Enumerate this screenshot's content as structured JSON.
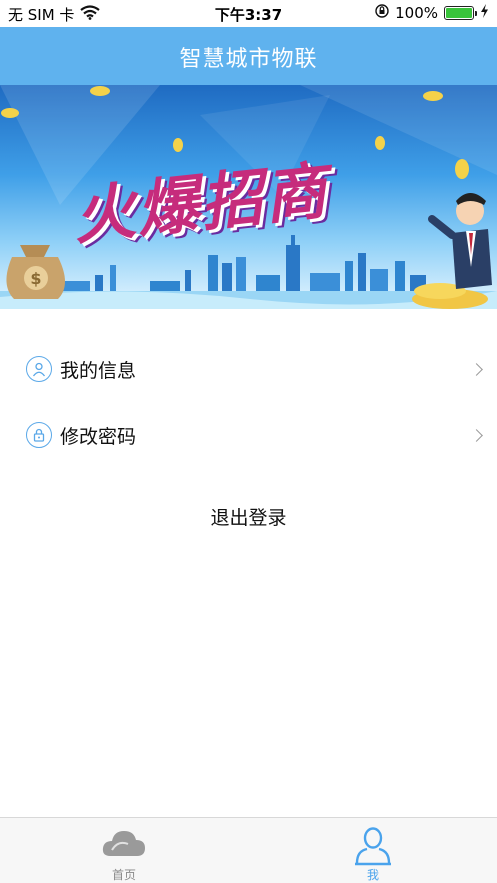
{
  "status_bar": {
    "carrier": "无 SIM 卡",
    "time": "下午3:37",
    "battery_percent": "100%",
    "battery_level": 1.0,
    "icons": [
      "wifi-icon",
      "orientation-lock-icon",
      "battery-icon",
      "charging-icon"
    ]
  },
  "nav": {
    "title": "智慧城市物联"
  },
  "banner": {
    "headline": "火爆招商"
  },
  "menu": {
    "items": [
      {
        "label": "我的信息",
        "icon": "user-icon"
      },
      {
        "label": "修改密码",
        "icon": "lock-icon"
      }
    ],
    "logout_label": "退出登录"
  },
  "tabs": [
    {
      "label": "首页",
      "icon": "cloud-icon",
      "active": false
    },
    {
      "label": "我",
      "icon": "person-icon",
      "active": true
    }
  ],
  "colors": {
    "nav_bg": "#5fb2ee",
    "accent": "#4aa3ec",
    "tab_inactive": "#8a8a8a",
    "battery_green": "#39c43b"
  }
}
